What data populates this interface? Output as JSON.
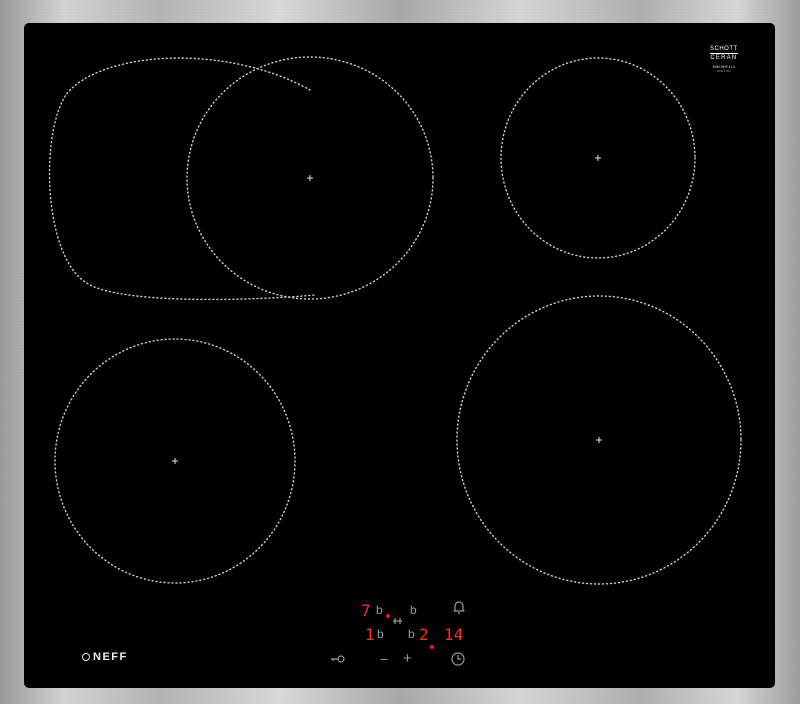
{
  "glass_label": {
    "line1": "SCHOTT",
    "line2": "CERAN",
    "model": "M5K5RF1L0",
    "serial": "0001215C"
  },
  "brand": "NEFF",
  "display": {
    "top_left_level": "7",
    "top_left_lock": "b",
    "top_right_lock": "b",
    "bottom_left_level": "1",
    "bottom_left_lock": "b",
    "bottom_right_lock": "b",
    "bottom_right_level": "2",
    "timer": "14"
  },
  "controls": {
    "minus": "−",
    "plus": "+"
  },
  "icons": [
    "bell-icon",
    "key-icon",
    "clock-icon",
    "pan-detect-icon"
  ],
  "colors": {
    "glass": "#000000",
    "display": "#ff2a2a",
    "zone_dots": "#cfcfcf"
  }
}
